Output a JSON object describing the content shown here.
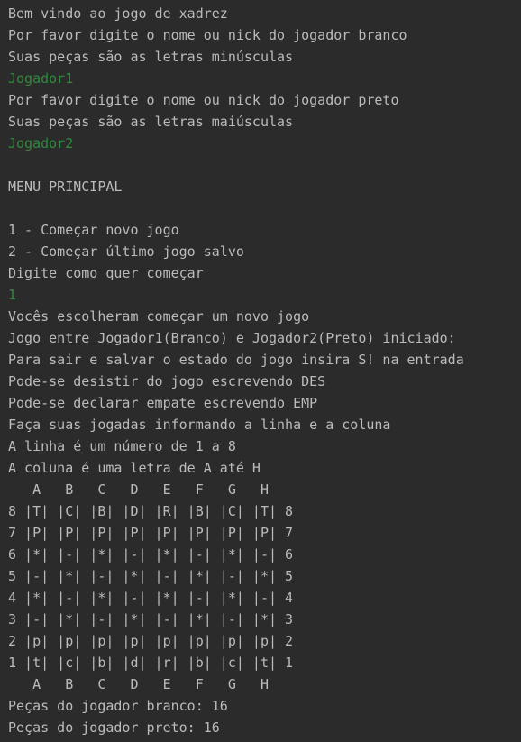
{
  "colors": {
    "background": "#2b2b2b",
    "output_text": "#bbbbbb",
    "user_input": "#2e8b3b"
  },
  "console": {
    "lines": [
      {
        "text": "Bem vindo ao jogo de xadrez",
        "kind": "output"
      },
      {
        "text": "Por favor digite o nome ou nick do jogador branco",
        "kind": "output"
      },
      {
        "text": "Suas peças são as letras minúsculas",
        "kind": "output"
      },
      {
        "text": "Jogador1",
        "kind": "input"
      },
      {
        "text": "Por favor digite o nome ou nick do jogador preto",
        "kind": "output"
      },
      {
        "text": "Suas peças são as letras maiúsculas",
        "kind": "output"
      },
      {
        "text": "Jogador2",
        "kind": "input"
      },
      {
        "text": "",
        "kind": "blank"
      },
      {
        "text": "MENU PRINCIPAL",
        "kind": "output"
      },
      {
        "text": "",
        "kind": "blank"
      },
      {
        "text": "1 - Começar novo jogo",
        "kind": "output"
      },
      {
        "text": "2 - Começar último jogo salvo",
        "kind": "output"
      },
      {
        "text": "Digite como quer começar",
        "kind": "output"
      },
      {
        "text": "1",
        "kind": "input"
      },
      {
        "text": "Vocês escolheram começar um novo jogo",
        "kind": "output"
      },
      {
        "text": "Jogo entre Jogador1(Branco) e Jogador2(Preto) iniciado:",
        "kind": "output"
      },
      {
        "text": "Para sair e salvar o estado do jogo insira S! na entrada",
        "kind": "output"
      },
      {
        "text": "Pode-se desistir do jogo escrevendo DES",
        "kind": "output"
      },
      {
        "text": "Pode-se declarar empate escrevendo EMP",
        "kind": "output"
      },
      {
        "text": "Faça suas jogadas informando a linha e a coluna",
        "kind": "output"
      },
      {
        "text": "A linha é um número de 1 a 8",
        "kind": "output"
      },
      {
        "text": "A coluna é uma letra de A até H",
        "kind": "output"
      },
      {
        "text": "   A   B   C   D   E   F   G   H",
        "kind": "output"
      },
      {
        "text": "8 |T| |C| |B| |D| |R| |B| |C| |T| 8",
        "kind": "output"
      },
      {
        "text": "7 |P| |P| |P| |P| |P| |P| |P| |P| 7",
        "kind": "output"
      },
      {
        "text": "6 |*| |-| |*| |-| |*| |-| |*| |-| 6",
        "kind": "output"
      },
      {
        "text": "5 |-| |*| |-| |*| |-| |*| |-| |*| 5",
        "kind": "output"
      },
      {
        "text": "4 |*| |-| |*| |-| |*| |-| |*| |-| 4",
        "kind": "output"
      },
      {
        "text": "3 |-| |*| |-| |*| |-| |*| |-| |*| 3",
        "kind": "output"
      },
      {
        "text": "2 |p| |p| |p| |p| |p| |p| |p| |p| 2",
        "kind": "output"
      },
      {
        "text": "1 |t| |c| |b| |d| |r| |b| |c| |t| 1",
        "kind": "output"
      },
      {
        "text": "   A   B   C   D   E   F   G   H",
        "kind": "output"
      },
      {
        "text": "Peças do jogador branco: 16",
        "kind": "output"
      },
      {
        "text": "Peças do jogador preto: 16",
        "kind": "output"
      }
    ]
  }
}
